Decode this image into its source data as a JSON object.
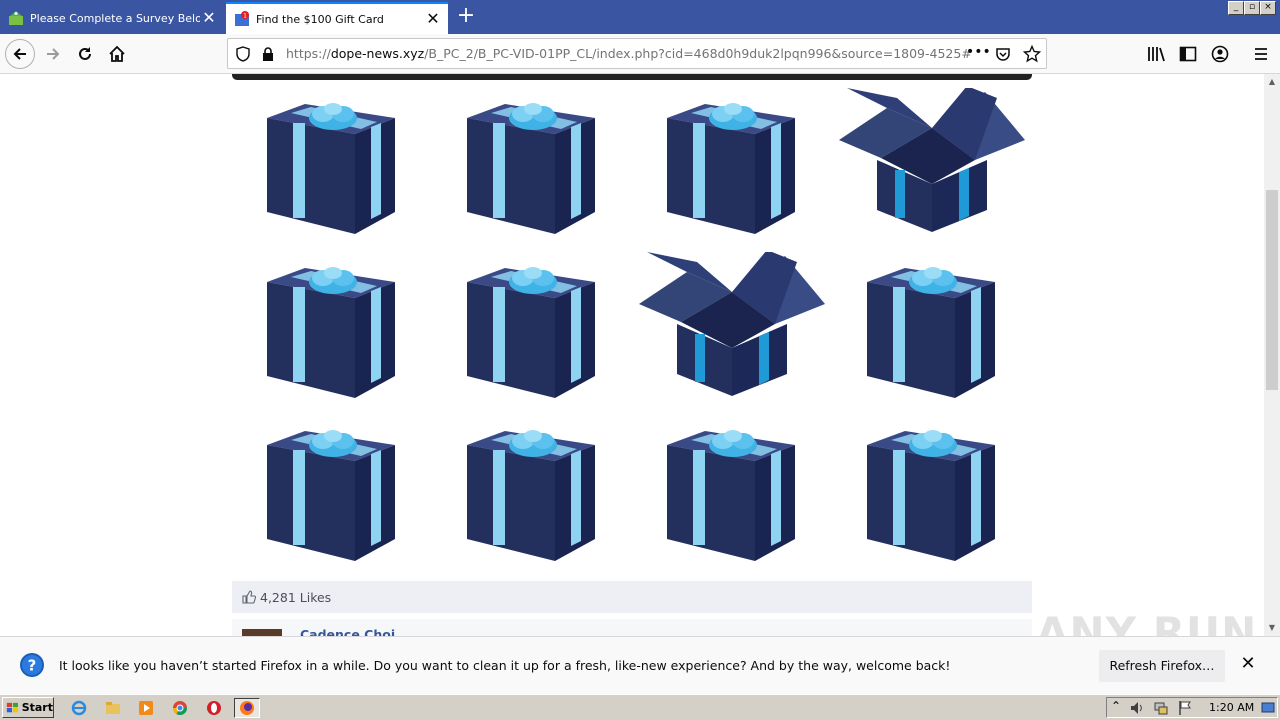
{
  "browser": {
    "tabs": [
      {
        "title": "Please Complete a Survey Below t",
        "active": false
      },
      {
        "title": "Find the $100 Gift Card",
        "active": true
      }
    ],
    "url": {
      "scheme": "https://",
      "host": "dope-news.xyz",
      "path": "/B_PC_2/B_PC-VID-01PP_CL/index.php?cid=468d0h9duk2lpqn996&source=1809-4525#"
    },
    "page_actions_icon": "•••",
    "window_controls": {
      "minimize": "_",
      "restore": "▫",
      "close": "×"
    }
  },
  "page": {
    "gifts": [
      {
        "state": "closed"
      },
      {
        "state": "closed"
      },
      {
        "state": "closed"
      },
      {
        "state": "open"
      },
      {
        "state": "closed"
      },
      {
        "state": "closed"
      },
      {
        "state": "open"
      },
      {
        "state": "closed"
      },
      {
        "state": "closed"
      },
      {
        "state": "closed"
      },
      {
        "state": "closed"
      },
      {
        "state": "closed"
      }
    ],
    "likes_text": "4,281 Likes",
    "comment_author": "Cadence Choi"
  },
  "notification": {
    "message": "It looks like you haven’t started Firefox in a while. Do you want to clean it up for a fresh, like-new experience? And by the way, welcome back!",
    "button": "Refresh Firefox…",
    "close": "✕"
  },
  "watermark": "ANY RUN",
  "taskbar": {
    "start_label": "Start",
    "clock": "1:20 AM"
  },
  "colors": {
    "titlebar": "#3a56a3",
    "box": "#23305e",
    "ribbon": "#8fd3f2",
    "open_ribbon": "#1f9ad6",
    "link": "#365899"
  }
}
